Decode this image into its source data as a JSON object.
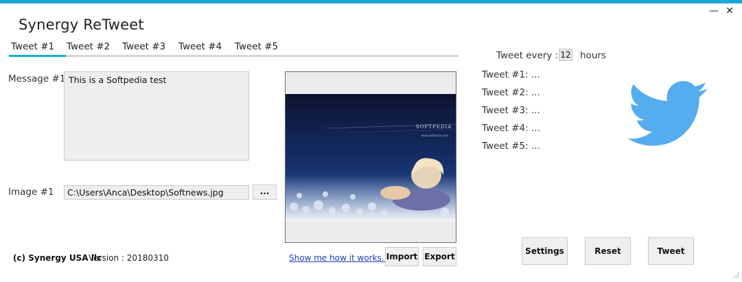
{
  "window": {
    "title": "Synergy ReTweet",
    "minimize_glyph": "—",
    "close_glyph": "✕"
  },
  "tabs": [
    {
      "label": "Tweet #1",
      "active": true
    },
    {
      "label": "Tweet #2",
      "active": false
    },
    {
      "label": "Tweet #3",
      "active": false
    },
    {
      "label": "Tweet #4",
      "active": false
    },
    {
      "label": "Tweet #5",
      "active": false
    }
  ],
  "form": {
    "message_label": "Message #1",
    "message_value": "This is a Softpedia test",
    "image_label": "Image #1",
    "image_path": "C:\\Users\\Anca\\Desktop\\Softnews.jpg",
    "browse_label": "..."
  },
  "preview": {
    "banner_text": "SOFTPEDIA",
    "banner_sub": "www.softpedia.com"
  },
  "schedule": {
    "prefix": "Tweet every :",
    "value": "12",
    "unit": "hours"
  },
  "tweet_status": [
    "Tweet #1: ...",
    "Tweet #2: ...",
    "Tweet #3: ...",
    "Tweet #4: ...",
    "Tweet #5: ..."
  ],
  "footer": {
    "copyright": "(c) Synergy USA llc",
    "version": "Version : 20180310",
    "help_link": "Show me how it works...",
    "import_label": "Import",
    "export_label": "Export"
  },
  "actions": {
    "settings_label": "Settings",
    "reset_label": "Reset",
    "tweet_label": "Tweet"
  },
  "colors": {
    "accent": "#1aa7d8",
    "twitter_blue": "#55acee",
    "link": "#1a3fb4"
  },
  "icons": {
    "brand": "twitter-bird-icon",
    "resize": "resize-grip-icon"
  }
}
